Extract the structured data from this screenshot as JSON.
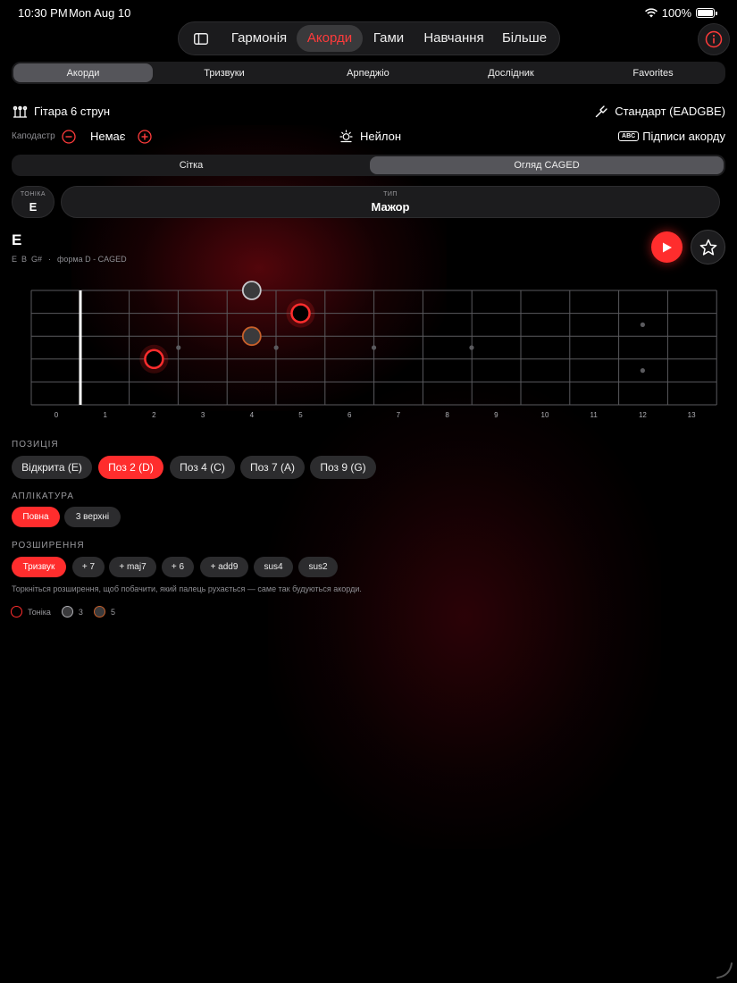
{
  "status": {
    "time": "10:30 PM",
    "date": "Mon Aug 10",
    "battery": "100%"
  },
  "nav": {
    "items": [
      "Гармонія",
      "Акорди",
      "Гами",
      "Навчання",
      "Більше"
    ],
    "active": 1
  },
  "subtabs": {
    "items": [
      "Акорди",
      "Тризвуки",
      "Арпеджіо",
      "Дослідник",
      "Favorites"
    ],
    "active": 0
  },
  "instrument": "Гітара 6 струн",
  "tuning": "Стандарт (EADGBE)",
  "capo": {
    "label": "Каподастр",
    "value": "Немає"
  },
  "string_type": "Нейлон",
  "labels_toggle": {
    "badge": "ABC",
    "label": "Підписи акорду"
  },
  "view_seg": {
    "items": [
      "Сітка",
      "Огляд CAGED"
    ],
    "active": 1
  },
  "root": {
    "label": "ТОНІКА",
    "value": "E"
  },
  "type": {
    "label": "ТИП",
    "value": "Мажор"
  },
  "chord": {
    "name": "E",
    "notes": "E  B  G#",
    "separator": "·",
    "shape": "форма D - CAGED"
  },
  "fretboard": {
    "fret_numbers": [
      "0",
      "1",
      "2",
      "3",
      "4",
      "5",
      "6",
      "7",
      "8",
      "9",
      "10",
      "11",
      "12",
      "13"
    ],
    "inlay_single": [
      3,
      5,
      7,
      9
    ],
    "inlay_double": 12,
    "notes": [
      {
        "fret": 4,
        "row": 0,
        "role": "third"
      },
      {
        "fret": 5,
        "row": 1,
        "role": "root"
      },
      {
        "fret": 4,
        "row": 2,
        "role": "fifth"
      },
      {
        "fret": 2,
        "row": 3,
        "role": "root"
      }
    ]
  },
  "position": {
    "label": "ПОЗИЦІЯ",
    "items": [
      "Відкрита (E)",
      "Поз 2 (D)",
      "Поз 4 (C)",
      "Поз 7 (A)",
      "Поз 9 (G)"
    ],
    "active": 1
  },
  "fingering": {
    "label": "АПЛІКАТУРА",
    "items": [
      "Повна",
      "3 верхні"
    ],
    "active": 0
  },
  "extensions": {
    "label": "РОЗШИРЕННЯ",
    "items": [
      "Тризвук",
      "+ 7",
      "+ maj7",
      "+ 6",
      "+ add9",
      "sus4",
      "sus2"
    ],
    "active": 0,
    "hint": "Торкніться розширення, щоб побачити, який палець рухається — саме так будуються акорди."
  },
  "legend": [
    {
      "label": "Тоніка",
      "color": "#ff2d2d"
    },
    {
      "label": "3",
      "color": "#8e8e93"
    },
    {
      "label": "5",
      "color": "#c8602a"
    }
  ],
  "colors": {
    "accent": "#ff2d2d",
    "third": "#8e8e93",
    "fifth": "#c8602a"
  }
}
